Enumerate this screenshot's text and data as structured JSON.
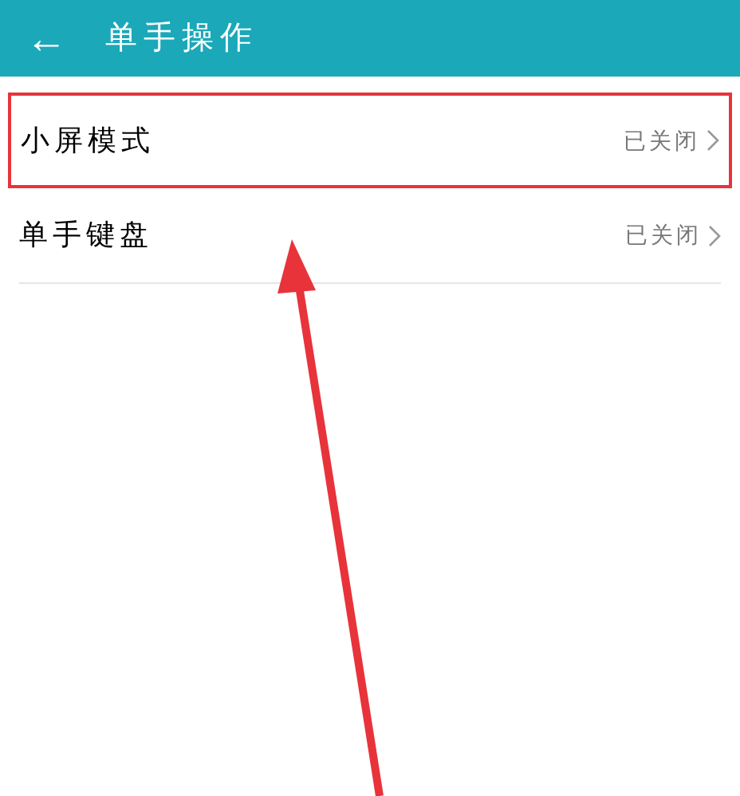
{
  "header": {
    "back": "←",
    "title": "单手操作"
  },
  "items": [
    {
      "label": "小屏模式",
      "value": "已关闭",
      "highlighted": true
    },
    {
      "label": "单手键盘",
      "value": "已关闭",
      "highlighted": false
    }
  ]
}
